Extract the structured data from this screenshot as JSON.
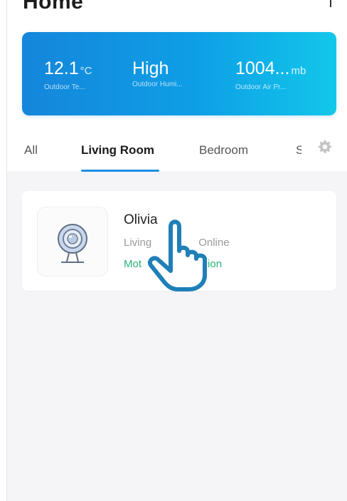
{
  "header": {
    "title": "Home"
  },
  "weather": [
    {
      "value": "12.1",
      "unit": "°C",
      "label": "Outdoor Te..."
    },
    {
      "value": "High",
      "unit": "",
      "label": "Outdoor Humi..."
    },
    {
      "value": "1004...",
      "unit": "mb",
      "label": "Outdoor Air Pr..."
    }
  ],
  "tabs": [
    {
      "label": "All"
    },
    {
      "label": "Living Room"
    },
    {
      "label": "Bedroom"
    },
    {
      "label": "S"
    }
  ],
  "device": {
    "name": "Olivia",
    "room": "Living",
    "status": "Online",
    "motion_prefix": "Mot",
    "motion_suffix": "ion"
  },
  "colors": {
    "accent": "#1b8fe3",
    "banner_start": "#1586db",
    "banner_end": "#12c7ea",
    "motion": "#28b37b"
  }
}
